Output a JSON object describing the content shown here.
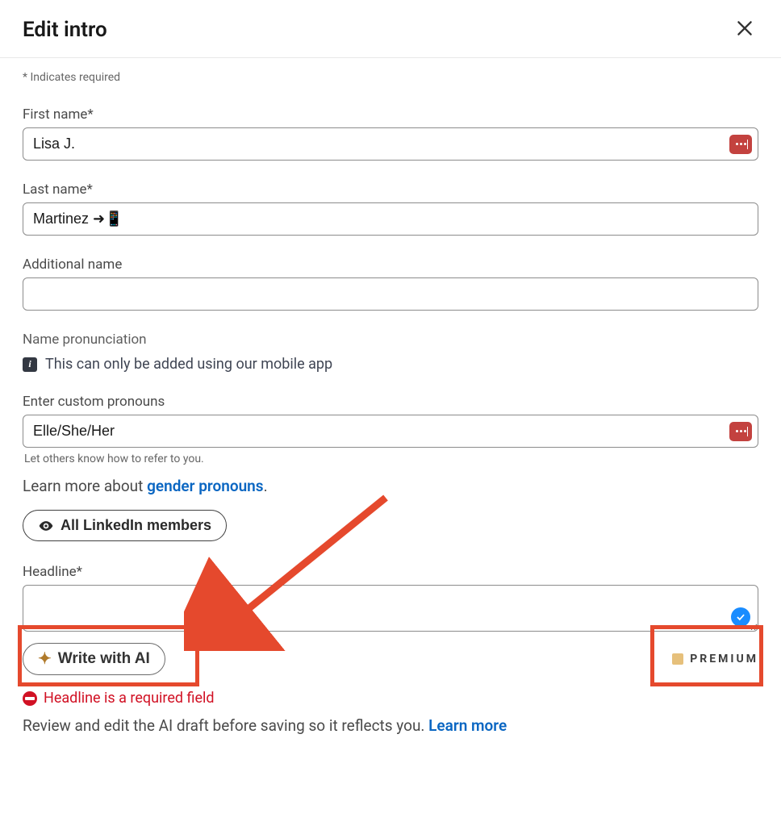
{
  "modal": {
    "title": "Edit intro",
    "required_note": "* Indicates required"
  },
  "fields": {
    "first_name": {
      "label": "First name*",
      "value": "Lisa J."
    },
    "last_name": {
      "label": "Last name*",
      "value": "Martinez ➜📱"
    },
    "additional_name": {
      "label": "Additional name",
      "value": ""
    },
    "pronouns": {
      "section": "Name pronunciation",
      "mobile_note": "This can only be added using our mobile app",
      "label": "Enter custom pronouns",
      "value": "Elle/She/Her",
      "helper": "Let others know how to refer to you.",
      "learn_prefix": "Learn more about ",
      "learn_link": "gender pronouns",
      "learn_suffix": "."
    },
    "visibility_button": "All LinkedIn members",
    "headline": {
      "label": "Headline*",
      "value": "",
      "ai_button": "Write with AI",
      "premium": "PREMIUM",
      "error": "Headline is a required field",
      "review_prefix": "Review and edit the AI draft before saving so it reflects you. ",
      "review_link": "Learn more"
    }
  }
}
